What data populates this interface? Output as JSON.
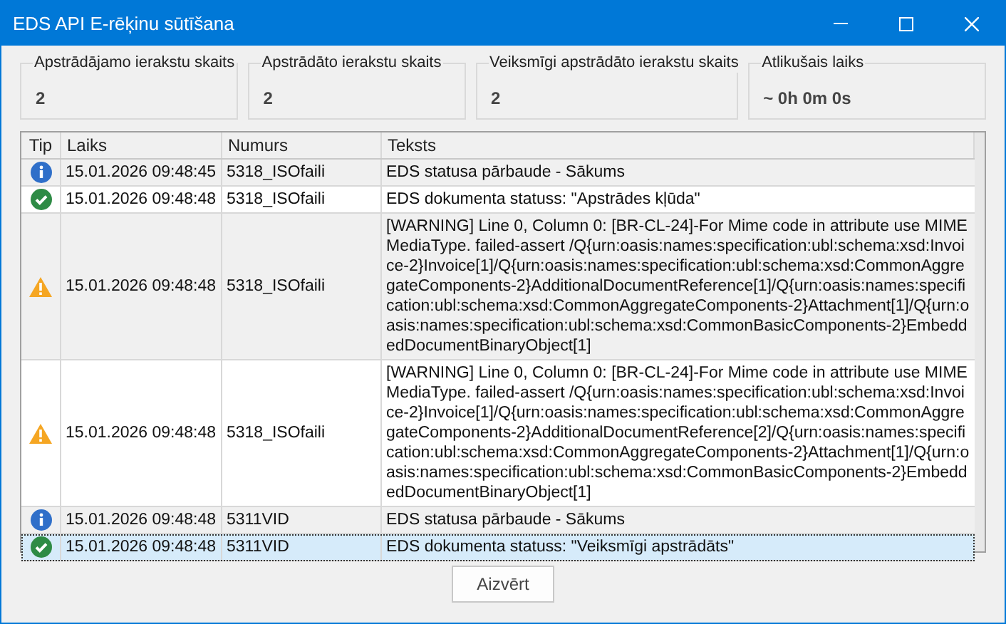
{
  "window": {
    "title": "EDS API E-rēķinu sūtīšana"
  },
  "counters": [
    {
      "label": "Apstrādājamo ierakstu skaits",
      "value": "2"
    },
    {
      "label": "Apstrādāto ierakstu skaits",
      "value": "2"
    },
    {
      "label": "Veiksmīgi apstrādāto ierakstu skaits",
      "value": "2"
    },
    {
      "label": "Atlikušais laiks",
      "value": "~ 0h 0m 0s"
    }
  ],
  "table": {
    "columns": [
      "Tip",
      "Laiks",
      "Numurs",
      "Teksts"
    ],
    "rows": [
      {
        "kind": "info",
        "time": "15.01.2026 09:48:45",
        "number": "5318_ISOfaili",
        "text": "EDS statusa pārbaude - Sākums",
        "selected": false
      },
      {
        "kind": "success",
        "time": "15.01.2026 09:48:48",
        "number": "5318_ISOfaili",
        "text": "EDS dokumenta statuss: \"Apstrādes kļūda\"",
        "selected": false
      },
      {
        "kind": "warning",
        "time": "15.01.2026 09:48:48",
        "number": "5318_ISOfaili",
        "text": "[WARNING] Line 0, Column 0: [BR-CL-24]-For Mime code in attribute use MIMEMediaType. failed-assert /Q{urn:oasis:names:specification:ubl:schema:xsd:Invoice-2}Invoice[1]/Q{urn:oasis:names:specification:ubl:schema:xsd:CommonAggregateComponents-2}AdditionalDocumentReference[1]/Q{urn:oasis:names:specification:ubl:schema:xsd:CommonAggregateComponents-2}Attachment[1]/Q{urn:oasis:names:specification:ubl:schema:xsd:CommonBasicComponents-2}EmbeddedDocumentBinaryObject[1]",
        "selected": false
      },
      {
        "kind": "warning",
        "time": "15.01.2026 09:48:48",
        "number": "5318_ISOfaili",
        "text": "[WARNING] Line 0, Column 0: [BR-CL-24]-For Mime code in attribute use MIMEMediaType. failed-assert /Q{urn:oasis:names:specification:ubl:schema:xsd:Invoice-2}Invoice[1]/Q{urn:oasis:names:specification:ubl:schema:xsd:CommonAggregateComponents-2}AdditionalDocumentReference[2]/Q{urn:oasis:names:specification:ubl:schema:xsd:CommonAggregateComponents-2}Attachment[1]/Q{urn:oasis:names:specification:ubl:schema:xsd:CommonBasicComponents-2}EmbeddedDocumentBinaryObject[1]",
        "selected": false
      },
      {
        "kind": "info",
        "time": "15.01.2026 09:48:48",
        "number": "5311VID",
        "text": "EDS statusa pārbaude - Sākums",
        "selected": false
      },
      {
        "kind": "success",
        "time": "15.01.2026 09:48:48",
        "number": "5311VID",
        "text": "EDS dokumenta statuss: \"Veiksmīgi apstrādāts\"",
        "selected": true
      }
    ]
  },
  "buttons": [
    "Aizvērt"
  ]
}
